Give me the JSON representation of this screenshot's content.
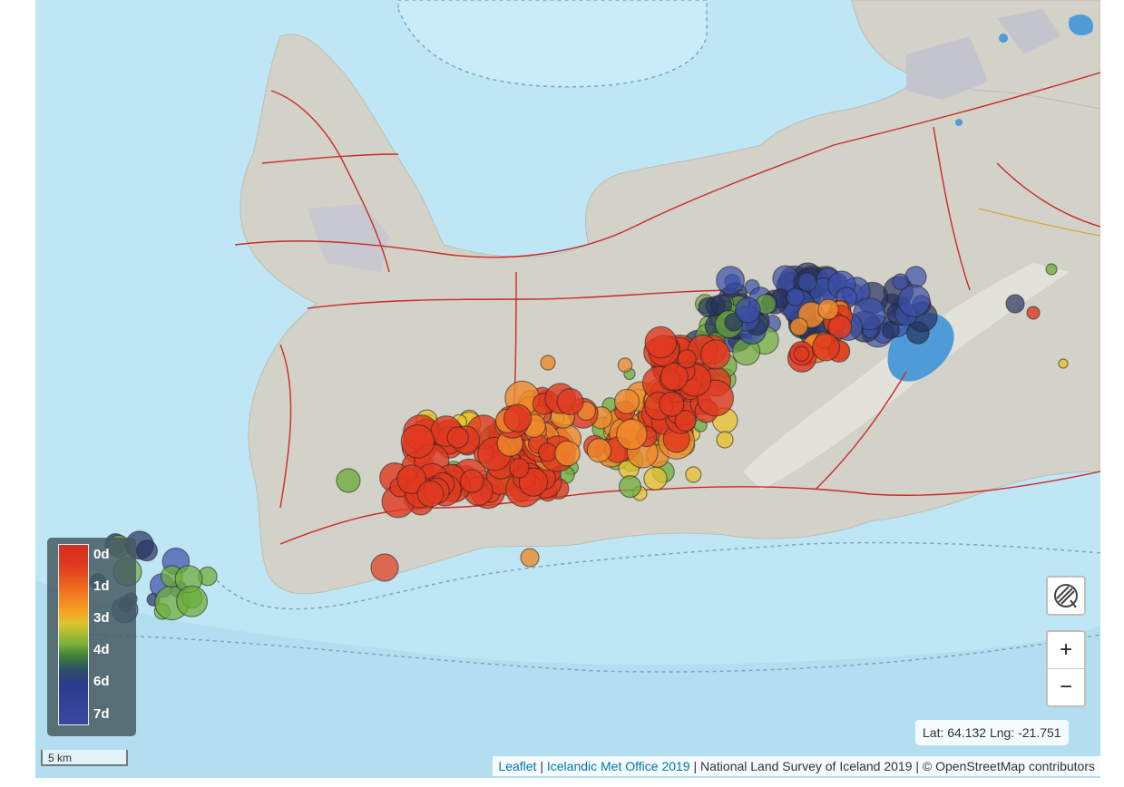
{
  "map": {
    "legend": {
      "labels": [
        "0d",
        "1d",
        "3d",
        "4d",
        "6d",
        "7d"
      ]
    },
    "controls": {
      "layers_icon": "layers-icon",
      "zoom_in": "+",
      "zoom_out": "−"
    },
    "coordinates": "Lat: 64.132 Lng: -21.751",
    "scale": "5 km",
    "attribution": {
      "leaflet": "Leaflet",
      "sep1": " | ",
      "imo": "Icelandic Met Office 2019",
      "rest": " | National Land Survey of Iceland 2019 | © OpenStreetMap contributors"
    },
    "colors": {
      "water": "#bfe6f5",
      "land": "#d2d2c8",
      "roads": "#cc2a2a",
      "quake_0d": "#e03a1f",
      "quake_2d": "#ef8a2a",
      "quake_3d": "#e8c12e",
      "quake_4d": "#6fae3c",
      "quake_6d": "#27325f",
      "quake_7d": "#3b4fa8"
    }
  }
}
